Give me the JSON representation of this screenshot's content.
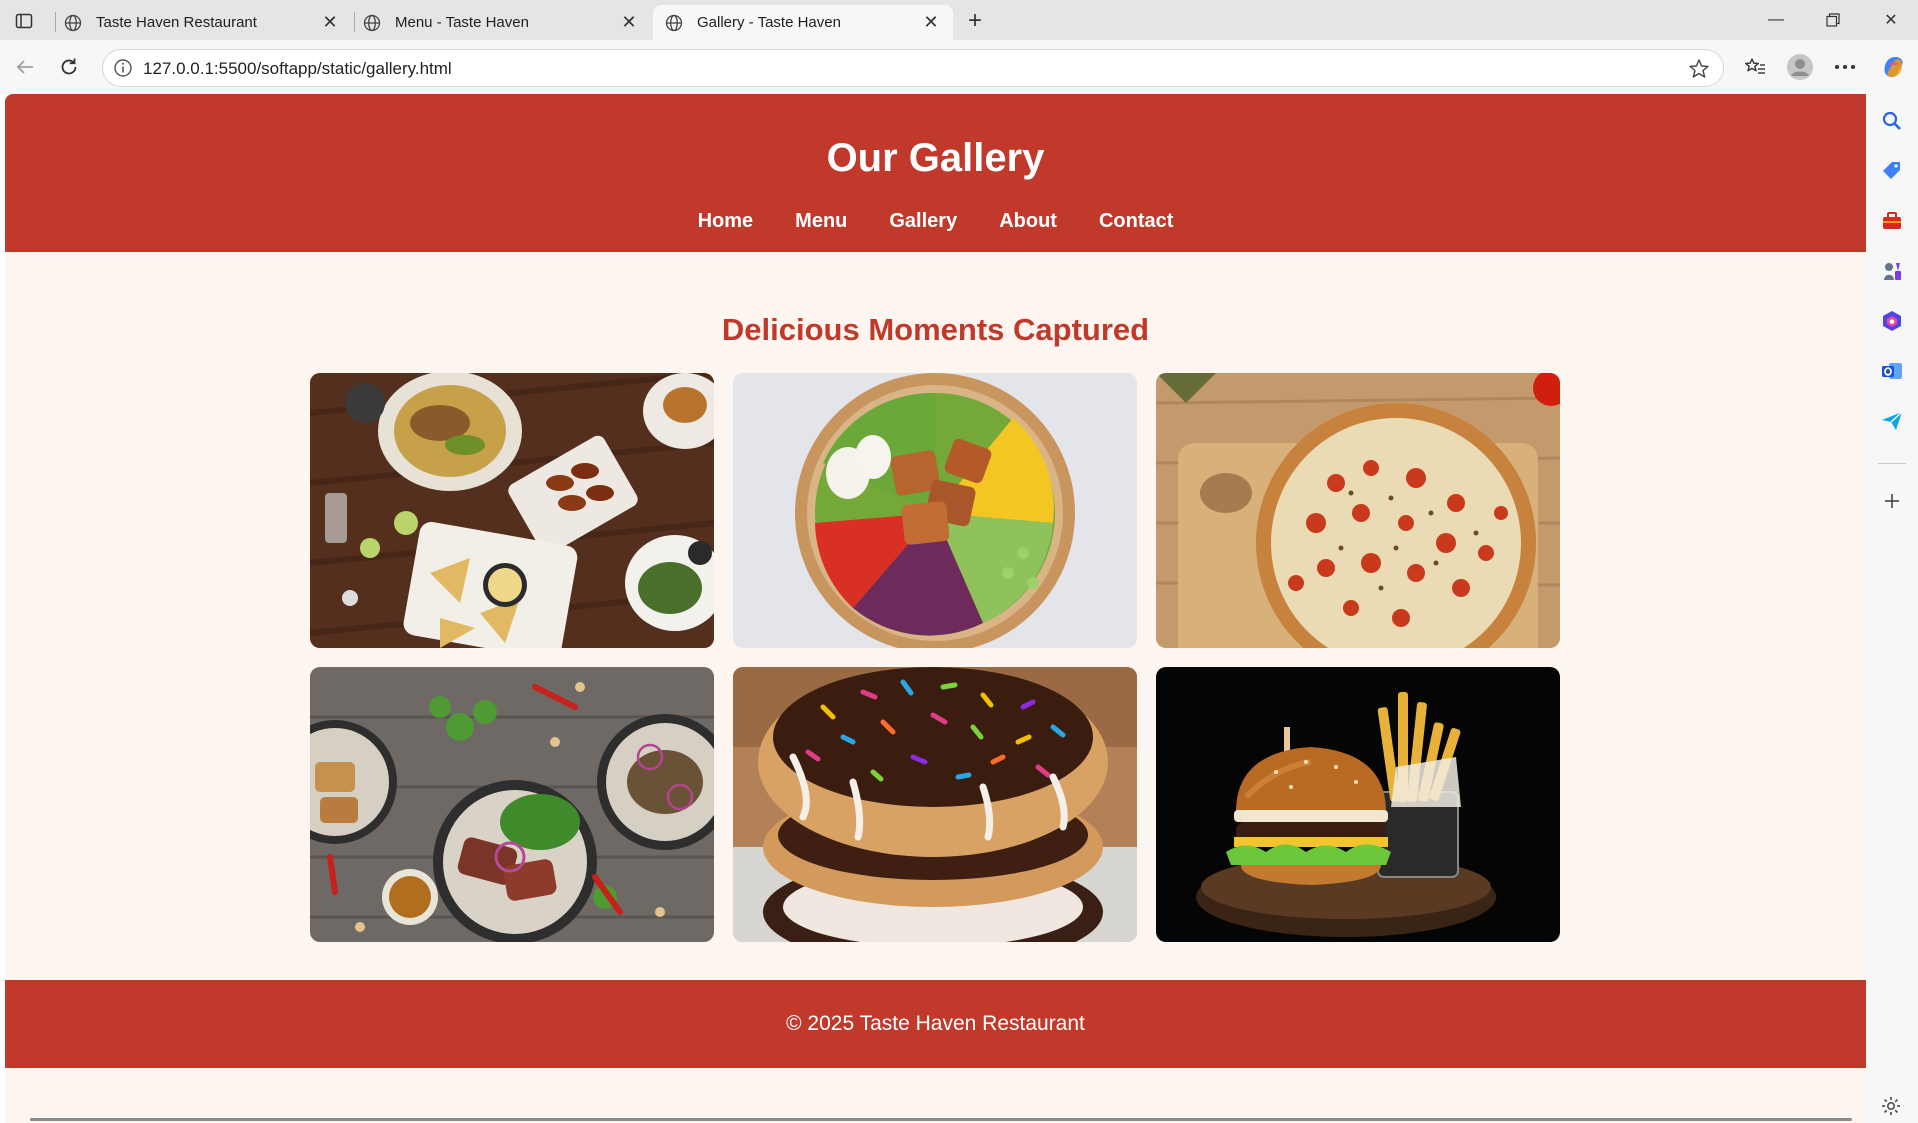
{
  "browser": {
    "tabs": [
      {
        "title": "Taste Haven Restaurant",
        "active": false
      },
      {
        "title": "Menu - Taste Haven",
        "active": false
      },
      {
        "title": "Gallery - Taste Haven",
        "active": true
      }
    ],
    "url": "127.0.0.1:5500/softapp/static/gallery.html"
  },
  "site": {
    "title": "Our Gallery",
    "nav": [
      "Home",
      "Menu",
      "Gallery",
      "About",
      "Contact"
    ],
    "section_title": "Delicious Moments Captured",
    "gallery": [
      {
        "subject": "mixed dishes on wooden table"
      },
      {
        "subject": "salad bowl with tofu"
      },
      {
        "subject": "pizza on cutting board"
      },
      {
        "subject": "steak and salad plates"
      },
      {
        "subject": "stacked sprinkle donuts"
      },
      {
        "subject": "burger with fries"
      }
    ],
    "footer": "© 2025 Taste Haven Restaurant"
  },
  "colors": {
    "brand": "#c0392b",
    "page_bg": "#fdf6f0"
  }
}
